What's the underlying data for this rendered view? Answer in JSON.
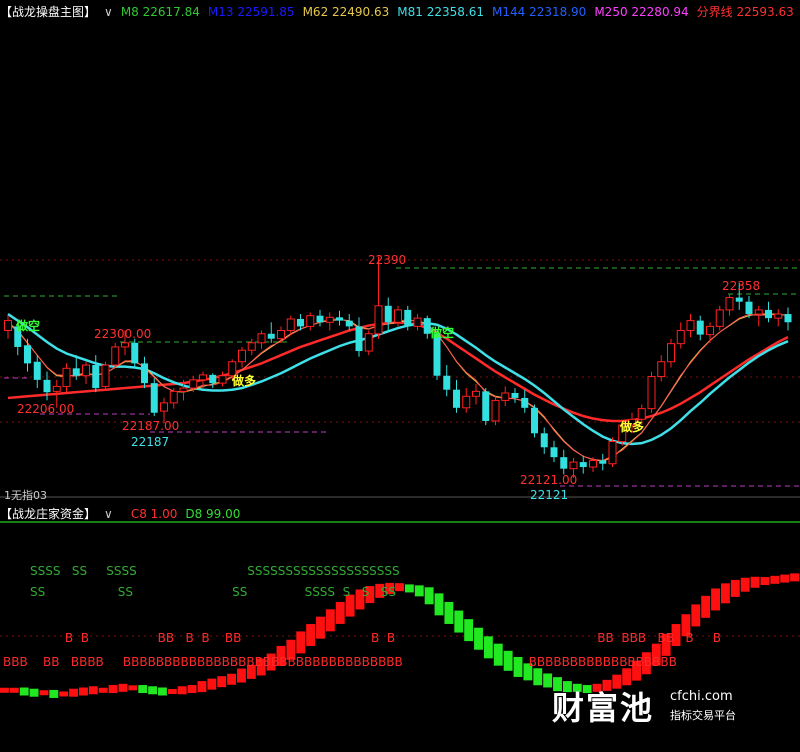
{
  "colors": {
    "bg": "#000000",
    "up": "#ff2020",
    "down": "#33e0e0",
    "ma8": "#32c832",
    "ma13": "#1a1aff",
    "ma62": "#e6c84a",
    "ma81": "#40e0e8",
    "ma144": "#2060ff",
    "ma250": "#ff40ff",
    "divider": "#ff2a2a",
    "green_bar": "#22e822",
    "red_bar": "#ff1010",
    "dash_green": "#33aa33",
    "dash_purple": "#c040c0",
    "grid": "#7a1010"
  },
  "main_panel": {
    "title": "【战龙操盘主图】",
    "indicators": [
      {
        "label": "M8 22617.84",
        "color": "#32c832"
      },
      {
        "label": "M13 22591.85",
        "color": "#1a1aff"
      },
      {
        "label": "M62 22490.63",
        "color": "#e6c84a"
      },
      {
        "label": "M81 22358.61",
        "color": "#40e0e8"
      },
      {
        "label": "M144 22318.90",
        "color": "#2060ff"
      },
      {
        "label": "M250 22280.94",
        "color": "#ff40ff"
      },
      {
        "label": "分界线 22593.63",
        "color": "#ff3030"
      }
    ],
    "price_labels": [
      {
        "text": "22390",
        "color": "#ff3030"
      },
      {
        "text": "22358",
        "color": "#ff3030"
      },
      {
        "text": "22300.00",
        "color": "#ff3030"
      },
      {
        "text": "22206.00",
        "color": "#ff3030"
      },
      {
        "text": "22187.00",
        "color": "#ff3030"
      },
      {
        "text": "22187",
        "color": "#40e0e8"
      },
      {
        "text": "22121.00",
        "color": "#ff3030"
      },
      {
        "text": "22121",
        "color": "#40e0e8"
      }
    ],
    "signals": [
      {
        "text": "做空",
        "color": "#33ff33"
      },
      {
        "text": "做多",
        "color": "#ffff33"
      },
      {
        "text": "做空",
        "color": "#33ff33"
      },
      {
        "text": "做多",
        "color": "#ffff33"
      }
    ],
    "footer_text": "1无指03"
  },
  "sub_panel": {
    "title": "【战龙庄家资金】",
    "c8": "C8 1.00",
    "d8": "D8 99.00",
    "s_row1": "SSSS   SS     SSSS                             SSSSSSSSSSSSSSSSSSSS",
    "s_row2": "SS                   SS                          SS               SSSS  S   S   SS",
    "b_row1": "                 B  B                  BB   B  B    BB                                  B  B                                                     BB  BBB   BB   B     B",
    "b_row2": "BBB    BB   BBBB     BBBBBBBBBBBBBBBBBBBBBBBBBBBBBBBBBB                                 BBBBBBBBBBBBBBBBBB"
  },
  "watermark": {
    "brand": "财富池",
    "domain": "cfchi.com",
    "tagline": "指标交易平台"
  },
  "chart_data": {
    "type": "candlestick",
    "ohlc": [
      [
        22300,
        22318,
        22290,
        22312
      ],
      [
        22305,
        22310,
        22270,
        22280
      ],
      [
        22282,
        22290,
        22250,
        22260
      ],
      [
        22262,
        22270,
        22230,
        22240
      ],
      [
        22240,
        22250,
        22215,
        22225
      ],
      [
        22226,
        22240,
        22206,
        22232
      ],
      [
        22232,
        22260,
        22225,
        22254
      ],
      [
        22254,
        22270,
        22240,
        22245
      ],
      [
        22245,
        22262,
        22235,
        22258
      ],
      [
        22258,
        22270,
        22225,
        22230
      ],
      [
        22232,
        22262,
        22228,
        22258
      ],
      [
        22258,
        22285,
        22255,
        22280
      ],
      [
        22280,
        22300,
        22270,
        22285
      ],
      [
        22285,
        22290,
        22255,
        22260
      ],
      [
        22260,
        22268,
        22230,
        22236
      ],
      [
        22236,
        22242,
        22196,
        22200
      ],
      [
        22202,
        22218,
        22187,
        22212
      ],
      [
        22212,
        22230,
        22205,
        22226
      ],
      [
        22226,
        22240,
        22215,
        22230
      ],
      [
        22230,
        22245,
        22225,
        22240
      ],
      [
        22240,
        22250,
        22230,
        22246
      ],
      [
        22246,
        22248,
        22230,
        22236
      ],
      [
        22236,
        22250,
        22232,
        22245
      ],
      [
        22245,
        22265,
        22240,
        22262
      ],
      [
        22262,
        22280,
        22255,
        22276
      ],
      [
        22276,
        22290,
        22270,
        22285
      ],
      [
        22285,
        22300,
        22278,
        22296
      ],
      [
        22296,
        22310,
        22285,
        22290
      ],
      [
        22290,
        22305,
        22285,
        22300
      ],
      [
        22300,
        22318,
        22295,
        22314
      ],
      [
        22314,
        22320,
        22300,
        22305
      ],
      [
        22305,
        22322,
        22300,
        22318
      ],
      [
        22318,
        22325,
        22305,
        22310
      ],
      [
        22310,
        22322,
        22300,
        22316
      ],
      [
        22316,
        22324,
        22306,
        22312
      ],
      [
        22312,
        22320,
        22300,
        22305
      ],
      [
        22305,
        22316,
        22268,
        22275
      ],
      [
        22275,
        22300,
        22270,
        22296
      ],
      [
        22296,
        22390,
        22290,
        22330
      ],
      [
        22330,
        22340,
        22300,
        22310
      ],
      [
        22310,
        22330,
        22305,
        22325
      ],
      [
        22325,
        22330,
        22300,
        22305
      ],
      [
        22305,
        22320,
        22300,
        22315
      ],
      [
        22315,
        22318,
        22290,
        22296
      ],
      [
        22296,
        22300,
        22240,
        22245
      ],
      [
        22245,
        22258,
        22220,
        22228
      ],
      [
        22228,
        22240,
        22200,
        22206
      ],
      [
        22206,
        22230,
        22200,
        22220
      ],
      [
        22220,
        22235,
        22210,
        22226
      ],
      [
        22226,
        22230,
        22185,
        22190
      ],
      [
        22190,
        22220,
        22185,
        22215
      ],
      [
        22215,
        22232,
        22208,
        22224
      ],
      [
        22224,
        22230,
        22212,
        22218
      ],
      [
        22218,
        22228,
        22200,
        22206
      ],
      [
        22206,
        22210,
        22170,
        22175
      ],
      [
        22175,
        22182,
        22150,
        22158
      ],
      [
        22158,
        22166,
        22140,
        22146
      ],
      [
        22146,
        22155,
        22125,
        22132
      ],
      [
        22132,
        22145,
        22121,
        22140
      ],
      [
        22140,
        22148,
        22126,
        22134
      ],
      [
        22134,
        22146,
        22128,
        22142
      ],
      [
        22142,
        22150,
        22130,
        22138
      ],
      [
        22138,
        22170,
        22134,
        22165
      ],
      [
        22165,
        22190,
        22160,
        22185
      ],
      [
        22185,
        22200,
        22175,
        22192
      ],
      [
        22192,
        22210,
        22185,
        22205
      ],
      [
        22205,
        22250,
        22200,
        22244
      ],
      [
        22244,
        22270,
        22238,
        22262
      ],
      [
        22262,
        22290,
        22255,
        22284
      ],
      [
        22284,
        22310,
        22278,
        22300
      ],
      [
        22300,
        22320,
        22292,
        22312
      ],
      [
        22312,
        22318,
        22288,
        22295
      ],
      [
        22295,
        22310,
        22285,
        22305
      ],
      [
        22305,
        22330,
        22300,
        22325
      ],
      [
        22325,
        22345,
        22318,
        22340
      ],
      [
        22340,
        22358,
        22325,
        22335
      ],
      [
        22335,
        22342,
        22315,
        22320
      ],
      [
        22320,
        22330,
        22305,
        22325
      ],
      [
        22325,
        22335,
        22310,
        22315
      ],
      [
        22315,
        22326,
        22305,
        22320
      ],
      [
        22320,
        22328,
        22300,
        22310
      ]
    ],
    "ma_fast": [
      22310,
      22300,
      22285,
      22270,
      22255,
      22245,
      22244,
      22246,
      22248,
      22246,
      22248,
      22255,
      22262,
      22262,
      22256,
      22244,
      22232,
      22226,
      22225,
      22228,
      22232,
      22235,
      22238,
      22244,
      22252,
      22262,
      22272,
      22280,
      22288,
      22296,
      22302,
      22306,
      22310,
      22312,
      22313,
      22312,
      22304,
      22302,
      22306,
      22308,
      22310,
      22312,
      22312,
      22308,
      22296,
      22280,
      22262,
      22248,
      22238,
      22226,
      22220,
      22218,
      22217,
      22214,
      22206,
      22194,
      22180,
      22166,
      22155,
      22147,
      22143,
      22141,
      22146,
      22156,
      22166,
      22176,
      22192,
      22208,
      22226,
      22244,
      22262,
      22276,
      22288,
      22298,
      22306,
      22314,
      22318,
      22320,
      22320,
      22320,
      22318
    ],
    "ma_slow": [
      22320,
      22312,
      22304,
      22295,
      22286,
      22278,
      22272,
      22268,
      22264,
      22260,
      22257,
      22256,
      22256,
      22255,
      22253,
      22248,
      22242,
      22237,
      22233,
      22230,
      22228,
      22227,
      22227,
      22228,
      22230,
      22234,
      22238,
      22243,
      22248,
      22254,
      22260,
      22266,
      22271,
      22276,
      22281,
      22285,
      22288,
      22291,
      22295,
      22299,
      22303,
      22306,
      22308,
      22309,
      22307,
      22302,
      22295,
      22287,
      22279,
      22270,
      22262,
      22255,
      22248,
      22241,
      22233,
      22224,
      22214,
      22204,
      22195,
      22186,
      22178,
      22171,
      22166,
      22163,
      22162,
      22163,
      22167,
      22173,
      22181,
      22191,
      22202,
      22212,
      22223,
      22233,
      22243,
      22252,
      22261,
      22269,
      22276,
      22282,
      22287
    ],
    "divider": [
      22218,
      22219,
      22220,
      22221,
      22222,
      22223,
      22224,
      22225,
      22226,
      22227,
      22228,
      22229,
      22230,
      22231,
      22232,
      22233,
      22234,
      22235,
      22236,
      22238,
      22240,
      22242,
      22245,
      22248,
      22252,
      22256,
      22260,
      22265,
      22270,
      22275,
      22280,
      22284,
      22288,
      22292,
      22296,
      22300,
      22303,
      22306,
      22308,
      22309,
      22310,
      22309,
      22307,
      22303,
      22297,
      22290,
      22282,
      22274,
      22266,
      22258,
      22250,
      22243,
      22236,
      22229,
      22222,
      22216,
      22210,
      22205,
      22200,
      22196,
      22193,
      22191,
      22190,
      22190,
      22191,
      22193,
      22196,
      22200,
      22205,
      22211,
      22218,
      22225,
      22233,
      22241,
      22249,
      22257,
      22265,
      22272,
      22279,
      22286,
      22292
    ],
    "zhuangjia": [
      12,
      12,
      11,
      10,
      10,
      9,
      9,
      10,
      11,
      12,
      12,
      13,
      14,
      14,
      13,
      12,
      11,
      11,
      12,
      13,
      15,
      17,
      19,
      21,
      24,
      27,
      31,
      35,
      40,
      45,
      51,
      57,
      63,
      69,
      75,
      81,
      86,
      90,
      93,
      95,
      96,
      95,
      93,
      89,
      82,
      75,
      68,
      61,
      54,
      47,
      41,
      36,
      31,
      27,
      23,
      20,
      17,
      15,
      14,
      13,
      14,
      16,
      19,
      23,
      28,
      34,
      41,
      49,
      57,
      65,
      73,
      80,
      86,
      91,
      95,
      98,
      100,
      101,
      102,
      103,
      104
    ],
    "y_range": [
      22100,
      22410
    ]
  }
}
